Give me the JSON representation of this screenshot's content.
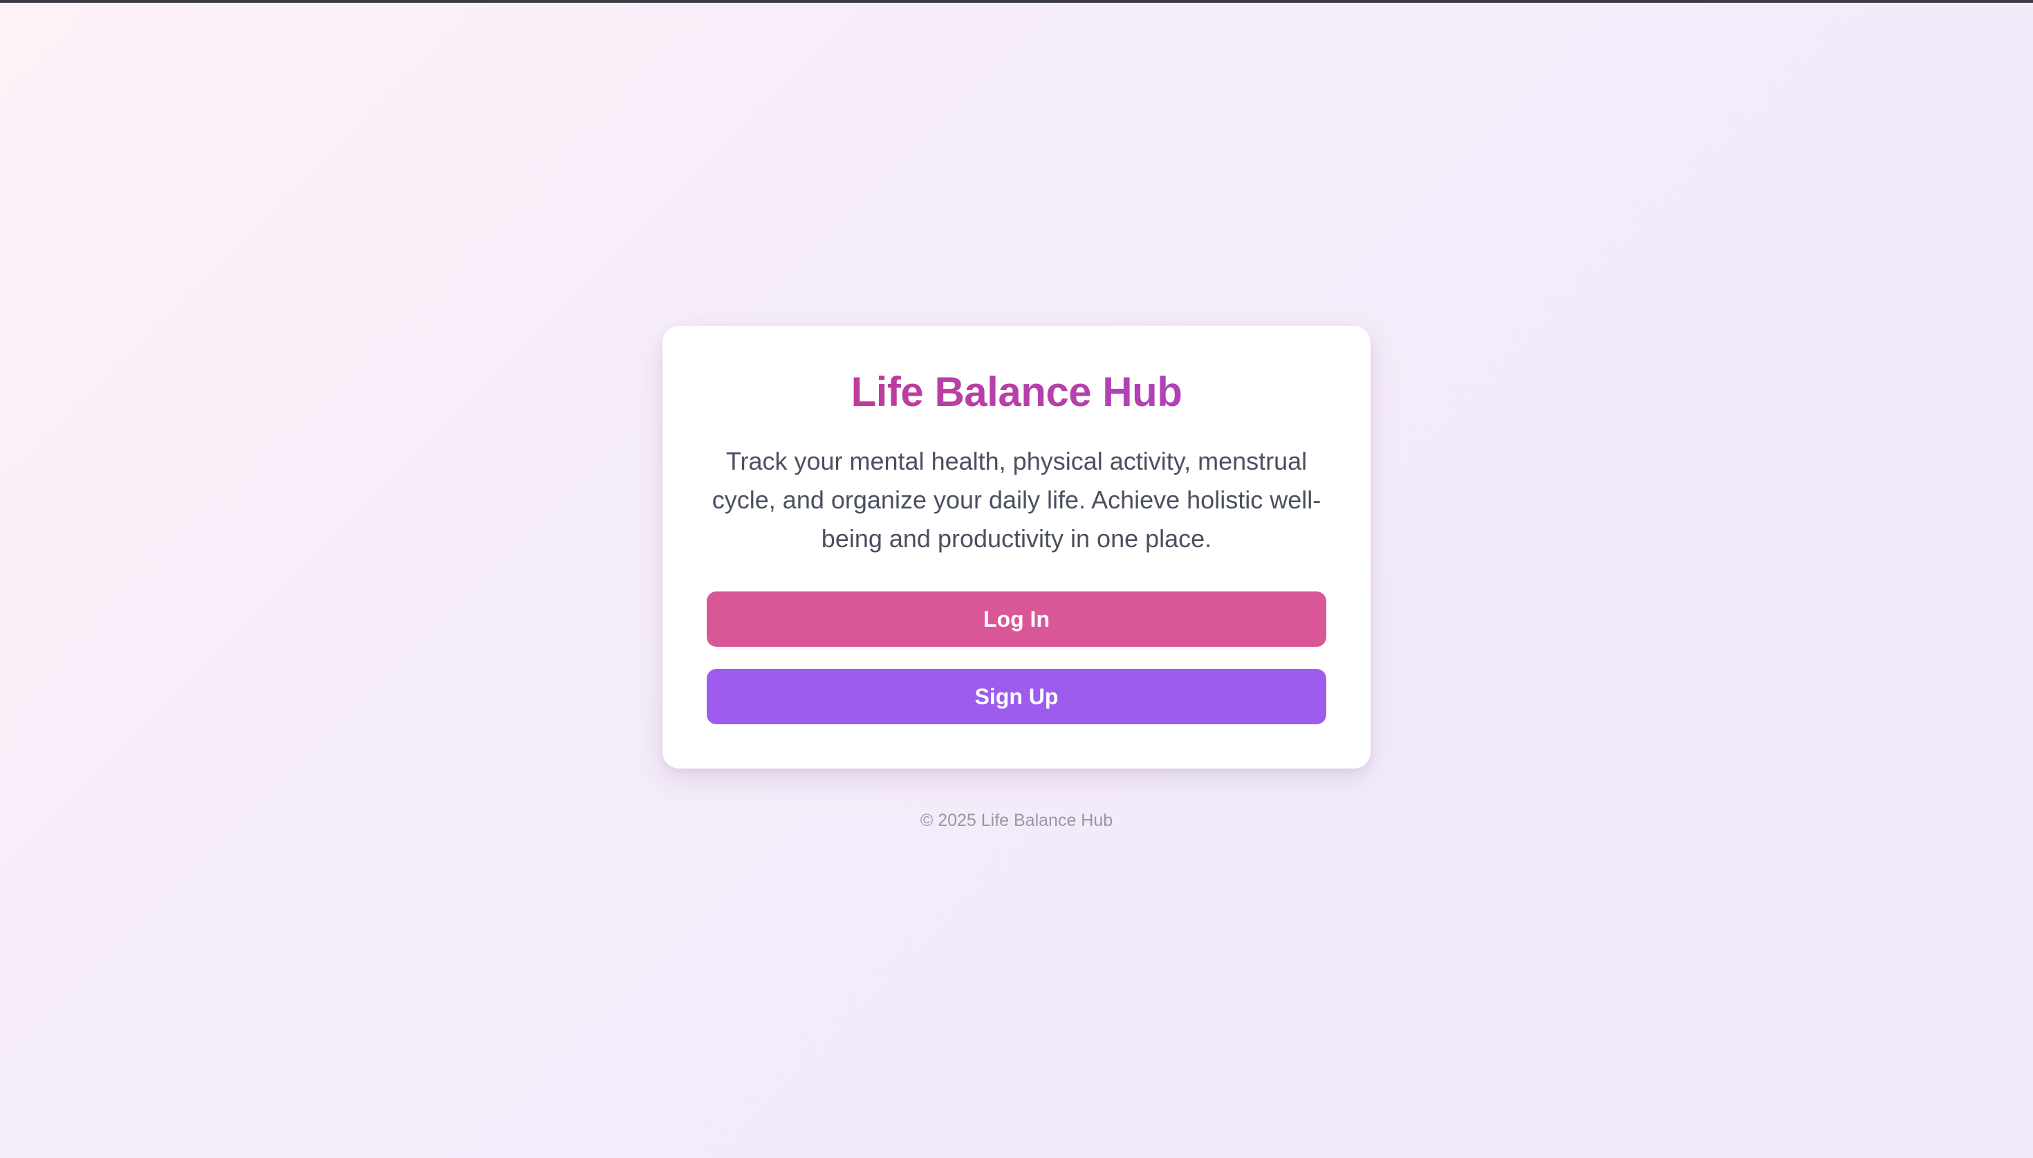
{
  "app": {
    "title": "Life Balance Hub",
    "description": "Track your mental health, physical activity, menstrual cycle, and organize your daily life. Achieve holistic well-being and productivity in one place."
  },
  "actions": {
    "login_label": "Log In",
    "signup_label": "Sign Up"
  },
  "footer": {
    "text": "© 2025 Life Balance Hub"
  },
  "colors": {
    "login_button": "#da5797",
    "signup_button": "#9d5cee",
    "title_gradient_start": "#c8378a",
    "title_gradient_end": "#a548c8",
    "description_text": "#4b5060",
    "footer_text": "#9a96a4"
  }
}
